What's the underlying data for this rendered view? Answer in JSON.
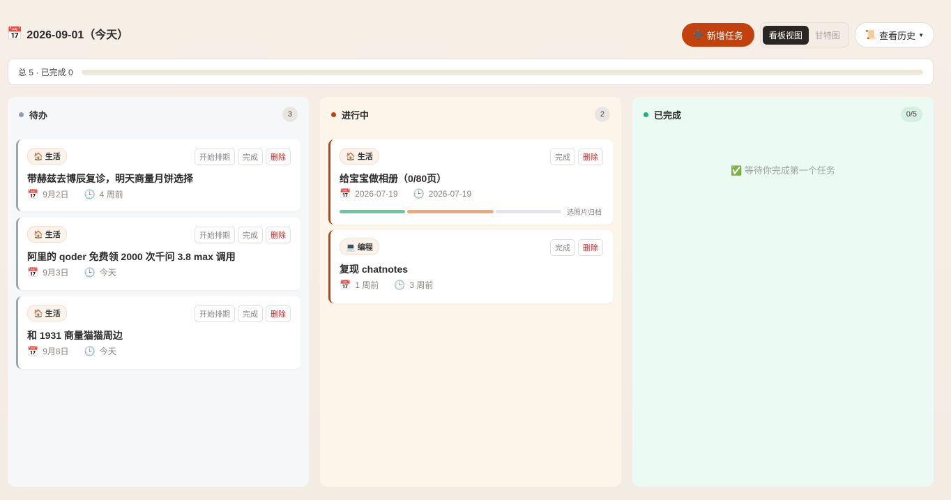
{
  "header": {
    "date_icon": "calendar-icon",
    "date_title": "2026-09-01（今天）",
    "new_task_label": "新增任务",
    "view_options": [
      {
        "label": "看板视图",
        "active": true
      },
      {
        "label": "甘特图",
        "active": false
      }
    ],
    "history_label": "查看历史",
    "accent_color": "#c2410c"
  },
  "progress": {
    "summary": "总 5 · 已完成 0",
    "completed_fraction": 0
  },
  "columns": {
    "todo": {
      "title": "待办",
      "count": "3",
      "dot_color": "#8f9bb0",
      "cards": [
        {
          "tag": "生活",
          "title": "带赫兹去博辰复诊，明天商量月饼选择",
          "date": "9月2日",
          "age": "4 周前",
          "btn_start": "开始排期",
          "btn_done": "完成",
          "btn_delete": "删除"
        },
        {
          "tag": "生活",
          "title": "阿里的 qoder 免费领 2000 次千问 3.8 max 调用",
          "date": "9月3日",
          "age": "今天",
          "btn_start": "开始排期",
          "btn_done": "完成",
          "btn_delete": "删除"
        },
        {
          "tag": "生活",
          "title": "和 1931 商量猫猫周边",
          "date": "9月8日",
          "age": "今天",
          "btn_start": "开始排期",
          "btn_done": "完成",
          "btn_delete": "删除"
        }
      ]
    },
    "doing": {
      "title": "进行中",
      "count": "2",
      "dot_color": "#c2410c",
      "cards": [
        {
          "tag": "生活",
          "title": "给宝宝做相册（0/80页）",
          "date": "2026-07-19",
          "age": "2026-07-19",
          "btn_done": "完成",
          "btn_delete": "删除",
          "subtask_label": "选照片归档"
        },
        {
          "tag": "编程",
          "title": "复现 chatnotes",
          "date": "1 周前",
          "age": "3 周前",
          "btn_done": "完成",
          "btn_delete": "删除"
        }
      ]
    },
    "done": {
      "title": "已完成",
      "count": "0/5",
      "dot_color": "#10b981",
      "empty_text": "等待你完成第一个任务"
    }
  }
}
